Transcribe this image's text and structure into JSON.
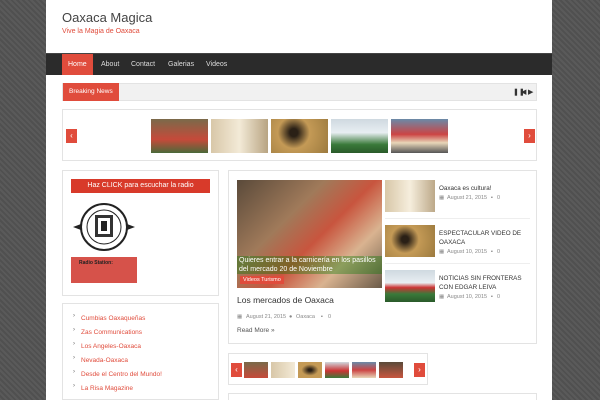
{
  "site": {
    "title": "Oaxaca Magica",
    "tagline": "Vive la Magia de Oaxaca"
  },
  "nav": {
    "items": [
      "Home",
      "About",
      "Contact",
      "Galerias",
      "Videos"
    ],
    "active": "Home"
  },
  "breaking": {
    "label": "Breaking News",
    "controls": [
      "pause",
      "prev",
      "next"
    ]
  },
  "slider": {
    "prev_icon": "chevron-left-icon",
    "next_icon": "chevron-right-icon"
  },
  "radio": {
    "banner": "Haz CLICK para escuchar la radio",
    "station_label": "Radio Station:"
  },
  "links": [
    "Cumbias Oaxaqueñas",
    "Zas Communications",
    "Los Angeles-Oaxaca",
    "Nevada-Oaxaca",
    "Desde el Centro del Mundo!",
    "La Risa Magazine"
  ],
  "featured": {
    "category": "Videos Turismo",
    "overlay_text": "Quieres entrar a la carnicería en los pasillos del mercado 20 de Noviembre",
    "title": "Los mercados de Oaxaca",
    "date": "August 21, 2015",
    "author": "Oaxaca",
    "comments": "0",
    "read_more": "Read More »"
  },
  "side_posts": [
    {
      "title": "Oaxaca es cultura!",
      "date": "August 21, 2015",
      "comments": "0"
    },
    {
      "title": "ESPECTACULAR VIDEO DE OAXACA",
      "date": "August 10, 2015",
      "comments": "0"
    },
    {
      "title": "NOTICIAS SIN FRONTERAS CON EDGAR LEIVA",
      "date": "August 10, 2015",
      "comments": "0"
    }
  ],
  "colors": {
    "accent": "#e04c3c",
    "nav_bg": "#2b2b2b"
  }
}
